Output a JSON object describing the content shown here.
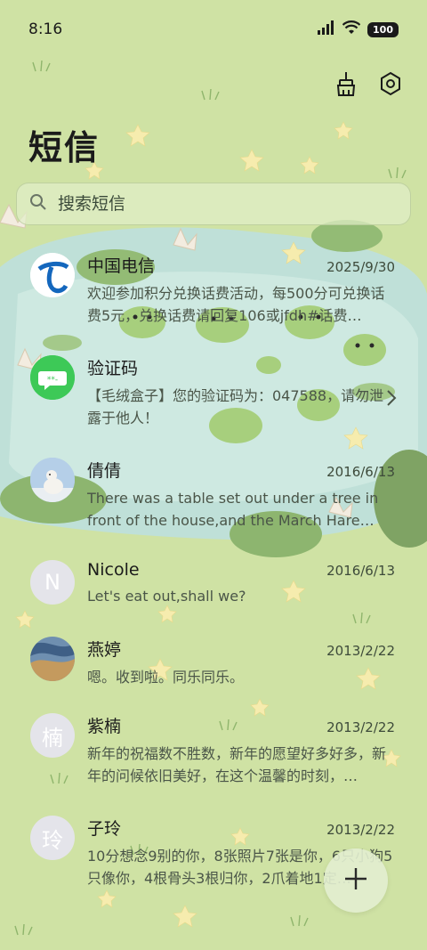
{
  "status_bar": {
    "time": "8:16",
    "battery": "100"
  },
  "toolbar": {
    "clean_icon": "broom-icon",
    "settings_icon": "gear-icon"
  },
  "page": {
    "title": "短信"
  },
  "search": {
    "placeholder": "搜索短信"
  },
  "conversations": [
    {
      "name": "中国电信",
      "date": "2025/9/30",
      "preview": "欢迎参加积分兑换话费活动，每500分可兑换话费5元，兑换话费请回复106或jfdh#话费…",
      "avatar_letter": "",
      "avatar_icon": "china-telecom-logo"
    },
    {
      "name": "验证码",
      "date": "",
      "preview": "【毛绒盒子】您的验证码为：047588，请勿泄露于他人！",
      "avatar_letter": "",
      "avatar_icon": "chat-bubble-icon"
    },
    {
      "name": "倩倩",
      "date": "2016/6/13",
      "preview": "There was a table set out under a tree in front of the house,and the March Hare an…",
      "avatar_letter": "",
      "avatar_icon": "polar-bear-photo"
    },
    {
      "name": "Nicole",
      "date": "2016/6/13",
      "preview": "Let's eat out,shall we?",
      "avatar_letter": "N",
      "avatar_icon": ""
    },
    {
      "name": "燕婷",
      "date": "2013/2/22",
      "preview": "嗯。收到啦。同乐同乐。",
      "avatar_letter": "",
      "avatar_icon": "painting-photo"
    },
    {
      "name": "紫楠",
      "date": "2013/2/22",
      "preview": "新年的祝福数不胜数，新年的愿望好多好多，新年的问候依旧美好，在这个温馨的时刻，…",
      "avatar_letter": "楠",
      "avatar_icon": ""
    },
    {
      "name": "子玲",
      "date": "2013/2/22",
      "preview": "10分想念9别的你，8张照片7张是你，6只小狗5只像你，4根骨头3根归你，2爪着地1定…",
      "avatar_letter": "玲",
      "avatar_icon": ""
    }
  ],
  "fab": {
    "icon": "plus-icon"
  },
  "colors": {
    "background": "#cfe2a4",
    "pond": "#b8dcd6",
    "lily_pad": "#86ad6a"
  }
}
